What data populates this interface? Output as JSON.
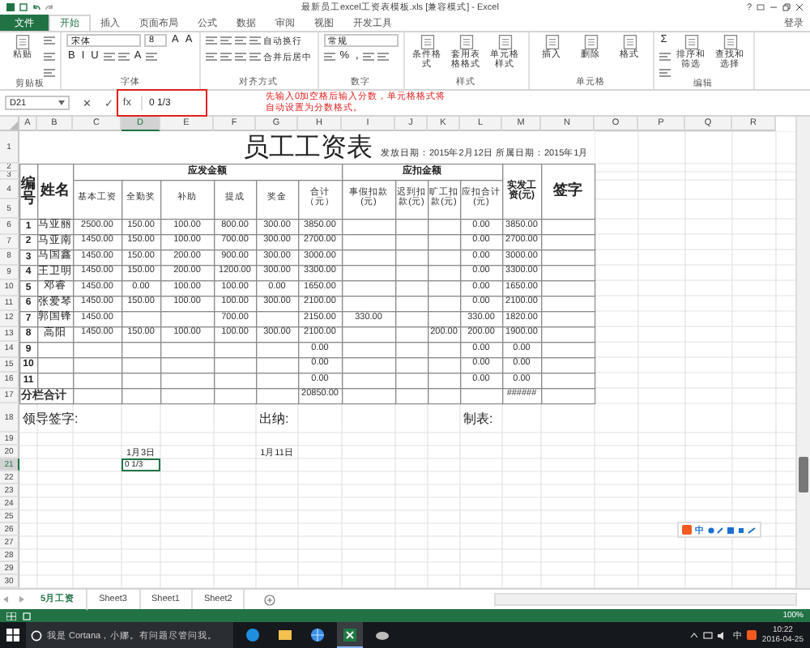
{
  "window": {
    "title": "最新员工excel工资表模板.xls [兼容模式] - Excel",
    "help": "?",
    "sign_in": "登录"
  },
  "tabs": [
    {
      "label": "文件",
      "kind": "file",
      "selected": false
    },
    {
      "label": "开始",
      "kind": "tab",
      "selected": true
    },
    {
      "label": "插入",
      "kind": "tab",
      "selected": false
    },
    {
      "label": "页面布局",
      "kind": "tab",
      "selected": false
    },
    {
      "label": "公式",
      "kind": "tab",
      "selected": false
    },
    {
      "label": "数据",
      "kind": "tab",
      "selected": false
    },
    {
      "label": "审阅",
      "kind": "tab",
      "selected": false
    },
    {
      "label": "视图",
      "kind": "tab",
      "selected": false
    },
    {
      "label": "开发工具",
      "kind": "tab",
      "selected": false
    }
  ],
  "ribbon": {
    "groups": [
      {
        "label": "剪贴板",
        "items": [
          {
            "kind": "big",
            "label": "粘贴"
          },
          {
            "kind": "stack",
            "lines": [
              [
                {
                  "kind": "tool"
                }
              ],
              [
                {
                  "kind": "tool"
                }
              ],
              [
                {
                  "kind": "tool"
                }
              ]
            ]
          }
        ]
      },
      {
        "label": "字体",
        "items": [
          {
            "kind": "stack",
            "lines": [
              [
                {
                  "kind": "field",
                  "label": "宋体"
                },
                {
                  "kind": "field",
                  "label": "8"
                },
                {
                  "kind": "char",
                  "label": "A"
                },
                {
                  "kind": "char",
                  "label": "A"
                }
              ],
              [
                {
                  "kind": "char",
                  "label": "B"
                },
                {
                  "kind": "char",
                  "label": "I"
                },
                {
                  "kind": "char",
                  "label": "U"
                },
                {
                  "kind": "tool"
                },
                {
                  "kind": "tool"
                },
                {
                  "kind": "char",
                  "label": "A"
                },
                {
                  "kind": "tool"
                }
              ]
            ]
          }
        ]
      },
      {
        "label": "对齐方式",
        "items": [
          {
            "kind": "stack",
            "lines": [
              [
                {
                  "kind": "tool"
                },
                {
                  "kind": "tool"
                },
                {
                  "kind": "tool"
                },
                {
                  "kind": "tool"
                },
                {
                  "kind": "text",
                  "label": "自动换行"
                }
              ],
              [
                {
                  "kind": "tool"
                },
                {
                  "kind": "tool"
                },
                {
                  "kind": "tool"
                },
                {
                  "kind": "tool"
                },
                {
                  "kind": "text",
                  "label": "合并后居中"
                }
              ]
            ]
          }
        ]
      },
      {
        "label": "数字",
        "items": [
          {
            "kind": "stack",
            "lines": [
              [
                {
                  "kind": "field",
                  "label": "常规"
                }
              ],
              [
                {
                  "kind": "tool"
                },
                {
                  "kind": "char",
                  "label": "%"
                },
                {
                  "kind": "char",
                  "label": ","
                },
                {
                  "kind": "tool"
                },
                {
                  "kind": "tool"
                }
              ]
            ]
          }
        ]
      },
      {
        "label": "样式",
        "items": [
          {
            "kind": "big",
            "label": "条件格式"
          },
          {
            "kind": "big",
            "label": "套用表格格式"
          },
          {
            "kind": "big",
            "label": "单元格样式"
          }
        ]
      },
      {
        "label": "单元格",
        "items": [
          {
            "kind": "big",
            "label": "插入"
          },
          {
            "kind": "big",
            "label": "删除"
          },
          {
            "kind": "big",
            "label": "格式"
          }
        ]
      },
      {
        "label": "编辑",
        "items": [
          {
            "kind": "stack",
            "lines": [
              [
                {
                  "kind": "char",
                  "label": "Σ"
                }
              ],
              [
                {
                  "kind": "tool"
                }
              ],
              [
                {
                  "kind": "tool"
                }
              ]
            ]
          },
          {
            "kind": "big",
            "label": "排序和筛选"
          },
          {
            "kind": "big",
            "label": "查找和选择"
          }
        ]
      }
    ]
  },
  "formula_bar": {
    "name_box": "D21",
    "buttons": [
      "✕",
      "✓",
      "fx"
    ],
    "formula": "0 1/3"
  },
  "annotation": {
    "lines": [
      "先输入0加空格后输入分数，单元格格式将",
      "自动设置为分数格式。"
    ]
  },
  "sheet": {
    "columns": [
      {
        "label": "A",
        "selected": false
      },
      {
        "label": "B",
        "selected": false
      },
      {
        "label": "C",
        "selected": false
      },
      {
        "label": "D",
        "selected": true
      },
      {
        "label": "E",
        "selected": false
      },
      {
        "label": "F",
        "selected": false
      },
      {
        "label": "G",
        "selected": false
      },
      {
        "label": "H",
        "selected": false
      },
      {
        "label": "I",
        "selected": false
      },
      {
        "label": "J",
        "selected": false
      },
      {
        "label": "K",
        "selected": false
      },
      {
        "label": "L",
        "selected": false
      },
      {
        "label": "M",
        "selected": false
      },
      {
        "label": "N",
        "selected": false
      },
      {
        "label": "O",
        "selected": false
      },
      {
        "label": "P",
        "selected": false
      },
      {
        "label": "Q",
        "selected": false
      },
      {
        "label": "R",
        "selected": false
      }
    ],
    "row_numbers": [
      {
        "label": "1",
        "selected": false
      },
      {
        "label": "2",
        "selected": false
      },
      {
        "label": "3",
        "selected": false
      },
      {
        "label": "4",
        "selected": false
      },
      {
        "label": "5",
        "selected": false
      },
      {
        "label": "6",
        "selected": false
      },
      {
        "label": "7",
        "selected": false
      },
      {
        "label": "8",
        "selected": false
      },
      {
        "label": "9",
        "selected": false
      },
      {
        "label": "10",
        "selected": false
      },
      {
        "label": "11",
        "selected": false
      },
      {
        "label": "12",
        "selected": false
      },
      {
        "label": "13",
        "selected": false
      },
      {
        "label": "14",
        "selected": false
      },
      {
        "label": "15",
        "selected": false
      },
      {
        "label": "16",
        "selected": false
      },
      {
        "label": "17",
        "selected": false
      },
      {
        "label": "18",
        "selected": false
      },
      {
        "label": "19",
        "selected": false
      },
      {
        "label": "20",
        "selected": false
      },
      {
        "label": "21",
        "selected": true
      },
      {
        "label": "22",
        "selected": false
      },
      {
        "label": "23",
        "selected": false
      },
      {
        "label": "24",
        "selected": false
      },
      {
        "label": "25",
        "selected": false
      },
      {
        "label": "26",
        "selected": false
      },
      {
        "label": "27",
        "selected": false
      },
      {
        "label": "28",
        "selected": false
      },
      {
        "label": "29",
        "selected": false
      },
      {
        "label": "30",
        "selected": false
      }
    ],
    "title": "员工工资表",
    "date_note": "发放日期：2015年2月12日 所属日期：2015年1月",
    "header": {
      "number": "编号",
      "name": "姓名",
      "payable_group": "应发金额",
      "payable": [
        "基本工资",
        "全勤奖",
        "补助",
        "提成",
        "奖金",
        "合计（元）"
      ],
      "deduct_group": "应扣金额",
      "deduct": [
        "事假扣款(元)",
        "迟到扣款(元)",
        "旷工扣款(元)",
        "应扣合计(元)"
      ],
      "net": "实发工资(元)",
      "signature": "签字"
    },
    "rows": [
      {
        "number": "1",
        "name": "马亚丽",
        "basic_pay": "2500.00",
        "attendance_bonus": "150.00",
        "allowance": "100.00",
        "commission": "800.00",
        "bonus": "300.00",
        "payable_total": "3850.00",
        "deduction_total": "0.00",
        "net_pay": "3850.00"
      },
      {
        "number": "2",
        "name": "马亚南",
        "basic_pay": "1450.00",
        "attendance_bonus": "150.00",
        "allowance": "100.00",
        "commission": "700.00",
        "bonus": "300.00",
        "payable_total": "2700.00",
        "deduction_total": "0.00",
        "net_pay": "2700.00"
      },
      {
        "number": "3",
        "name": "马国鑫",
        "basic_pay": "1450.00",
        "attendance_bonus": "150.00",
        "allowance": "200.00",
        "commission": "900.00",
        "bonus": "300.00",
        "payable_total": "3000.00",
        "deduction_total": "0.00",
        "net_pay": "3000.00"
      },
      {
        "number": "4",
        "name": "王卫明",
        "basic_pay": "1450.00",
        "attendance_bonus": "150.00",
        "allowance": "200.00",
        "commission": "1200.00",
        "bonus": "300.00",
        "payable_total": "3300.00",
        "deduction_total": "0.00",
        "net_pay": "3300.00"
      },
      {
        "number": "5",
        "name": "邓睿",
        "basic_pay": "1450.00",
        "attendance_bonus": "0.00",
        "allowance": "100.00",
        "commission": "100.00",
        "bonus": "0.00",
        "payable_total": "1650.00",
        "deduction_total": "0.00",
        "net_pay": "1650.00"
      },
      {
        "number": "6",
        "name": "张爱琴",
        "basic_pay": "1450.00",
        "attendance_bonus": "150.00",
        "allowance": "100.00",
        "commission": "100.00",
        "bonus": "300.00",
        "payable_total": "2100.00",
        "deduction_total": "0.00",
        "net_pay": "2100.00"
      },
      {
        "number": "7",
        "name": "郭国锋",
        "basic_pay": "1450.00",
        "commission": "700.00",
        "payable_total": "2150.00",
        "leave_deduction": "330.00",
        "deduction_total": "330.00",
        "net_pay": "1820.00"
      },
      {
        "number": "8",
        "name": "高阳",
        "basic_pay": "1450.00",
        "attendance_bonus": "150.00",
        "allowance": "100.00",
        "commission": "100.00",
        "bonus": "300.00",
        "payable_total": "2100.00",
        "absence_deduction": "200.00",
        "deduction_total": "200.00",
        "net_pay": "1900.00"
      },
      {
        "number": "9",
        "payable_total": "0.00",
        "deduction_total": "0.00",
        "net_pay": "0.00"
      },
      {
        "number": "10",
        "payable_total": "0.00",
        "deduction_total": "0.00",
        "net_pay": "0.00"
      },
      {
        "number": "11",
        "payable_total": "0.00",
        "deduction_total": "0.00",
        "net_pay": "0.00"
      }
    ],
    "total": {
      "label": "分栏合计",
      "payable_total": "20850.00",
      "net_pay": "######"
    },
    "signatures": [
      "领导签字:",
      "出纳:",
      "制表:"
    ],
    "dates": [
      "1月3日",
      "1月11日"
    ],
    "active_cell": {
      "value": "0 1/3"
    }
  },
  "ime_toolbar": {
    "mode": "中"
  },
  "sheet_tabs": [
    {
      "label": "5月工资",
      "selected": true
    },
    {
      "label": "Sheet3",
      "selected": false
    },
    {
      "label": "Sheet1",
      "selected": false
    },
    {
      "label": "Sheet2",
      "selected": false
    }
  ],
  "status_bar": {
    "zoom": "100%"
  },
  "taskbar": {
    "search_placeholder": "我是 Cortana，小娜。有问题尽管问我。",
    "apps": [
      {
        "kind": "browser",
        "selected": false
      },
      {
        "kind": "folder",
        "selected": false
      },
      {
        "kind": "globe",
        "selected": false
      },
      {
        "kind": "excel",
        "selected": true
      },
      {
        "kind": "bird",
        "selected": false
      }
    ],
    "ime": "中",
    "time": "10:22",
    "date": "2016-04-25"
  }
}
